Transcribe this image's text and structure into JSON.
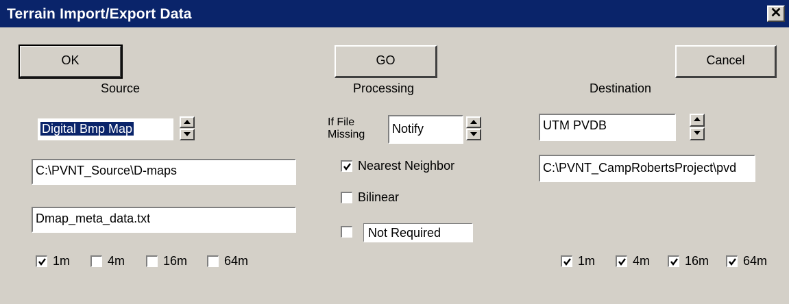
{
  "window": {
    "title": "Terrain Import/Export  Data",
    "close_glyph": "✕"
  },
  "buttons": {
    "ok": "OK",
    "go": "GO",
    "cancel": "Cancel"
  },
  "source": {
    "heading": "Source",
    "format": "Digital Bmp Map",
    "path": "C:\\PVNT_Source\\D-maps",
    "meta_file": "Dmap_meta_data.txt",
    "resolutions": [
      {
        "label": "1m",
        "checked": true
      },
      {
        "label": "4m",
        "checked": false
      },
      {
        "label": "16m",
        "checked": false
      },
      {
        "label": "64m",
        "checked": false
      }
    ]
  },
  "processing": {
    "heading": "Processing",
    "if_missing_label_line1": "If File",
    "if_missing_label_line2": "Missing",
    "if_missing_value": "Notify",
    "options": [
      {
        "label": "Nearest Neighbor",
        "checked": true
      },
      {
        "label": "Bilinear",
        "checked": false
      }
    ],
    "extra_option": {
      "label": "Not Required",
      "checked": false
    }
  },
  "destination": {
    "heading": "Destination",
    "format": "UTM PVDB",
    "path": "C:\\PVNT_CampRobertsProject\\pvd",
    "resolutions": [
      {
        "label": "1m",
        "checked": true
      },
      {
        "label": "4m",
        "checked": true
      },
      {
        "label": "16m",
        "checked": true
      },
      {
        "label": "64m",
        "checked": true
      }
    ]
  },
  "icons": {
    "close": "close-icon",
    "spin_up": "arrow-up-icon",
    "spin_down": "arrow-down-icon",
    "check": "checkmark-icon"
  },
  "colors": {
    "titlebar": "#0a246a",
    "face": "#d4d0c8",
    "selection": "#0a246a"
  }
}
